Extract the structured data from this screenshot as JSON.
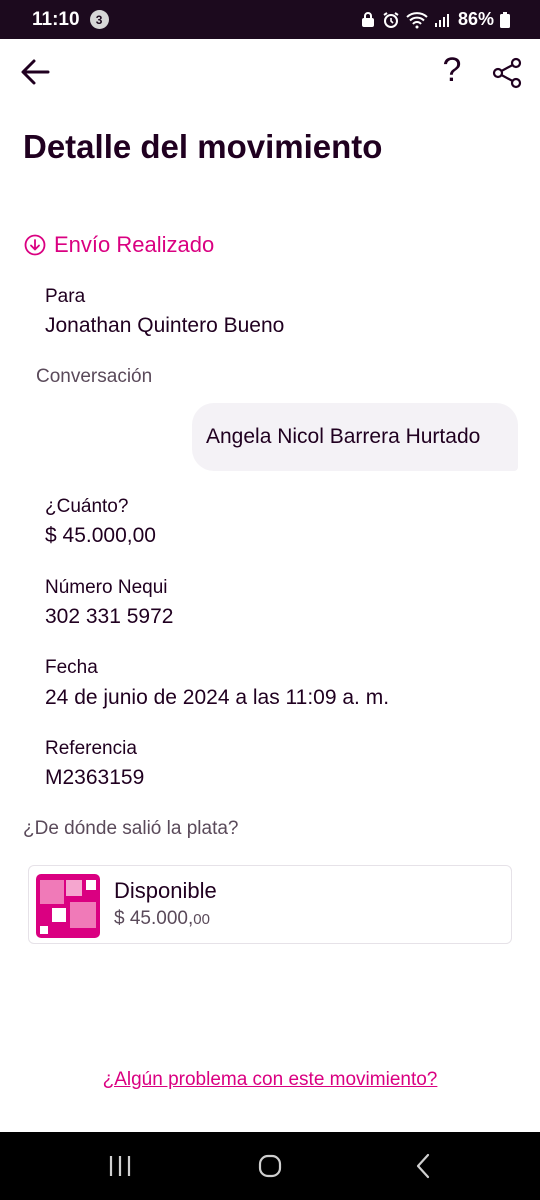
{
  "status_bar": {
    "time": "11:10",
    "notification_count": "3",
    "battery": "86%"
  },
  "header": {
    "title": "Detalle del movimiento",
    "help_label": "?"
  },
  "transaction": {
    "status": "Envío Realizado",
    "to_label": "Para",
    "to_value": "Jonathan Quintero Bueno",
    "conversation_label": "Conversación",
    "message": "Angela Nicol Barrera Hurtado",
    "amount_label": "¿Cuánto?",
    "amount_value": "$ 45.000,00",
    "number_label": "Número Nequi",
    "number_value": "302 331 5972",
    "date_label": "Fecha",
    "date_value": "24 de junio de 2024 a las 11:09 a. m.",
    "reference_label": "Referencia",
    "reference_value": "M2363159"
  },
  "source": {
    "question": "¿De dónde salió la plata?",
    "account_name": "Disponible",
    "account_amount_main": "$ 45.000,",
    "account_amount_cents": "00"
  },
  "footer": {
    "problem_link": "¿Algún problema con este movimiento?"
  },
  "colors": {
    "accent": "#da0081",
    "text": "#200020",
    "status_bar": "#1c0a1e",
    "bubble": "#f4f2f6"
  },
  "icons": [
    "back-arrow-icon",
    "help-icon",
    "share-icon",
    "arrow-down-circle-icon",
    "account-icon",
    "recents-icon",
    "home-icon",
    "nav-back-icon"
  ]
}
